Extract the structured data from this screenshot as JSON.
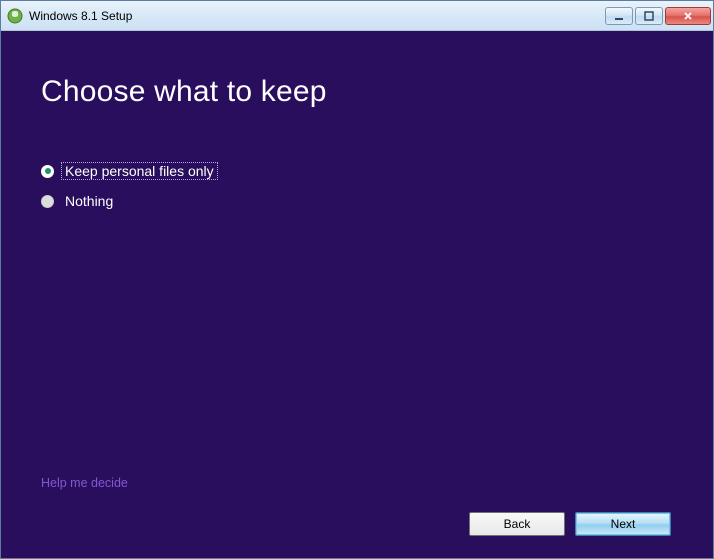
{
  "window": {
    "title": "Windows 8.1 Setup"
  },
  "main": {
    "heading": "Choose what to keep",
    "options": [
      {
        "label": "Keep personal files only",
        "selected": true
      },
      {
        "label": "Nothing",
        "selected": false
      }
    ],
    "help_link": "Help me decide"
  },
  "buttons": {
    "back": "Back",
    "next": "Next"
  }
}
